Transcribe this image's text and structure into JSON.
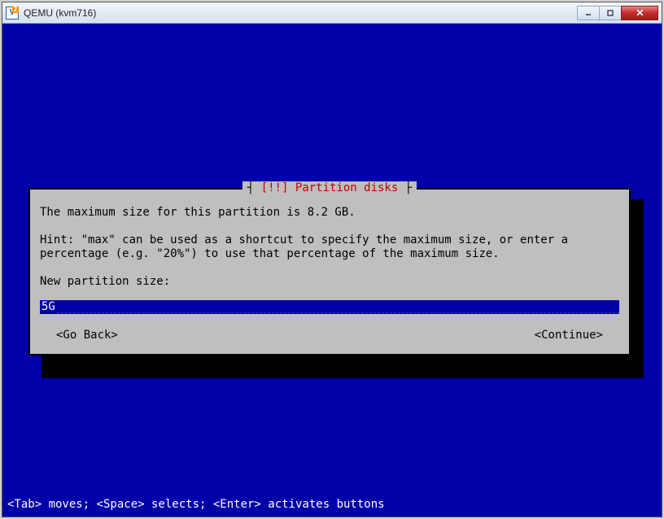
{
  "window": {
    "title": "QEMU (kvm716)"
  },
  "dialog": {
    "title_marker": "[!!]",
    "title": "Partition disks",
    "info": "The maximum size for this partition is 8.2 GB.",
    "hint": "Hint: \"max\" can be used as a shortcut to specify the maximum size, or enter a percentage (e.g. \"20%\") to use that percentage of the maximum size.",
    "prompt": "New partition size:",
    "input_value": "5G",
    "go_back": "<Go Back>",
    "continue": "<Continue>"
  },
  "footer": {
    "hint": "<Tab> moves; <Space> selects; <Enter> activates buttons"
  }
}
